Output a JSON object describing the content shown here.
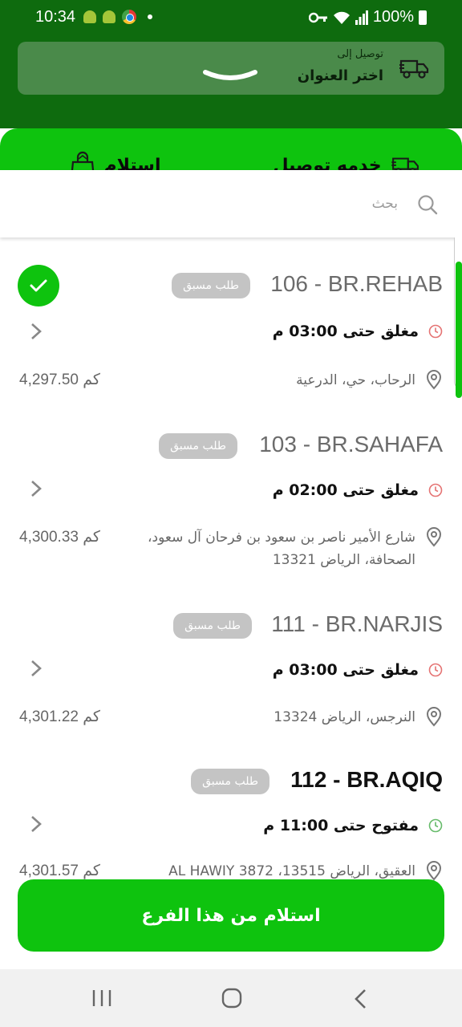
{
  "status_bar": {
    "time": "10:34",
    "battery": "100%",
    "icons": [
      "android-icon",
      "android-icon",
      "chrome-icon",
      "dot-icon",
      "key-icon",
      "wifi-icon",
      "signal-icon",
      "battery-icon"
    ]
  },
  "header": {
    "deliver_to_label": "توصيل إلى",
    "choose_address_label": "اختر العنوان"
  },
  "tabs": [
    {
      "label": "خدمه توصيل",
      "icon": "truck-icon",
      "active": false
    },
    {
      "label": "استلام",
      "icon": "shopping-bag-icon",
      "active": true
    }
  ],
  "search": {
    "placeholder": "بحث",
    "value": ""
  },
  "branches": [
    {
      "title": "106 - BR.REHAB",
      "badge": "طلب مسبق",
      "hours": "مغلق حتى 03:00 م",
      "status": "closed",
      "address": "الرحاب، حي، الدرعية",
      "distance": "4,297.50 كم",
      "selected": true
    },
    {
      "title": "103 - BR.SAHAFA",
      "badge": "طلب مسبق",
      "hours": "مغلق حتى 02:00 م",
      "status": "closed",
      "address": "شارع الأمير ناصر بن سعود بن فرحان آل سعود، الصحافة، الرياض 13321",
      "distance": "4,300.33 كم",
      "selected": false
    },
    {
      "title": "111 - BR.NARJIS",
      "badge": "طلب مسبق",
      "hours": "مغلق حتى 03:00 م",
      "status": "closed",
      "address": "النرجس، الرياض 13324",
      "distance": "4,301.22 كم",
      "selected": false
    },
    {
      "title": "112 - BR.AQIQ",
      "badge": "طلب مسبق",
      "hours": "مفتوح حتى 11:00 م",
      "status": "open",
      "address": "العقيق، الرياض 13515، 3872 AL HAWIY",
      "distance": "4,301.57 كم",
      "selected": false
    }
  ],
  "pickup_button_label": "استلام من هذا الفرع",
  "colors": {
    "brand_green": "#0ec30e",
    "header_dark_green": "#0e6b0e",
    "closed_icon": "#e57373",
    "open_icon": "#66bb6a",
    "badge_gray": "#c4c4c4"
  }
}
